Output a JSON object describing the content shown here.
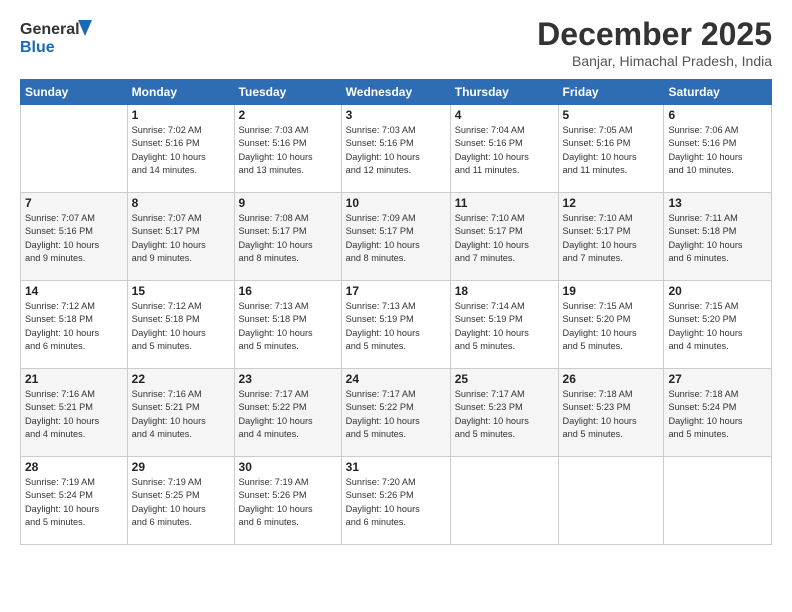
{
  "logo": {
    "line1": "General",
    "line2": "Blue"
  },
  "title": "December 2025",
  "subtitle": "Banjar, Himachal Pradesh, India",
  "days_of_week": [
    "Sunday",
    "Monday",
    "Tuesday",
    "Wednesday",
    "Thursday",
    "Friday",
    "Saturday"
  ],
  "weeks": [
    [
      {
        "num": "",
        "info": ""
      },
      {
        "num": "1",
        "info": "Sunrise: 7:02 AM\nSunset: 5:16 PM\nDaylight: 10 hours\nand 14 minutes."
      },
      {
        "num": "2",
        "info": "Sunrise: 7:03 AM\nSunset: 5:16 PM\nDaylight: 10 hours\nand 13 minutes."
      },
      {
        "num": "3",
        "info": "Sunrise: 7:03 AM\nSunset: 5:16 PM\nDaylight: 10 hours\nand 12 minutes."
      },
      {
        "num": "4",
        "info": "Sunrise: 7:04 AM\nSunset: 5:16 PM\nDaylight: 10 hours\nand 11 minutes."
      },
      {
        "num": "5",
        "info": "Sunrise: 7:05 AM\nSunset: 5:16 PM\nDaylight: 10 hours\nand 11 minutes."
      },
      {
        "num": "6",
        "info": "Sunrise: 7:06 AM\nSunset: 5:16 PM\nDaylight: 10 hours\nand 10 minutes."
      }
    ],
    [
      {
        "num": "7",
        "info": "Sunrise: 7:07 AM\nSunset: 5:16 PM\nDaylight: 10 hours\nand 9 minutes."
      },
      {
        "num": "8",
        "info": "Sunrise: 7:07 AM\nSunset: 5:17 PM\nDaylight: 10 hours\nand 9 minutes."
      },
      {
        "num": "9",
        "info": "Sunrise: 7:08 AM\nSunset: 5:17 PM\nDaylight: 10 hours\nand 8 minutes."
      },
      {
        "num": "10",
        "info": "Sunrise: 7:09 AM\nSunset: 5:17 PM\nDaylight: 10 hours\nand 8 minutes."
      },
      {
        "num": "11",
        "info": "Sunrise: 7:10 AM\nSunset: 5:17 PM\nDaylight: 10 hours\nand 7 minutes."
      },
      {
        "num": "12",
        "info": "Sunrise: 7:10 AM\nSunset: 5:17 PM\nDaylight: 10 hours\nand 7 minutes."
      },
      {
        "num": "13",
        "info": "Sunrise: 7:11 AM\nSunset: 5:18 PM\nDaylight: 10 hours\nand 6 minutes."
      }
    ],
    [
      {
        "num": "14",
        "info": "Sunrise: 7:12 AM\nSunset: 5:18 PM\nDaylight: 10 hours\nand 6 minutes."
      },
      {
        "num": "15",
        "info": "Sunrise: 7:12 AM\nSunset: 5:18 PM\nDaylight: 10 hours\nand 5 minutes."
      },
      {
        "num": "16",
        "info": "Sunrise: 7:13 AM\nSunset: 5:18 PM\nDaylight: 10 hours\nand 5 minutes."
      },
      {
        "num": "17",
        "info": "Sunrise: 7:13 AM\nSunset: 5:19 PM\nDaylight: 10 hours\nand 5 minutes."
      },
      {
        "num": "18",
        "info": "Sunrise: 7:14 AM\nSunset: 5:19 PM\nDaylight: 10 hours\nand 5 minutes."
      },
      {
        "num": "19",
        "info": "Sunrise: 7:15 AM\nSunset: 5:20 PM\nDaylight: 10 hours\nand 5 minutes."
      },
      {
        "num": "20",
        "info": "Sunrise: 7:15 AM\nSunset: 5:20 PM\nDaylight: 10 hours\nand 4 minutes."
      }
    ],
    [
      {
        "num": "21",
        "info": "Sunrise: 7:16 AM\nSunset: 5:21 PM\nDaylight: 10 hours\nand 4 minutes."
      },
      {
        "num": "22",
        "info": "Sunrise: 7:16 AM\nSunset: 5:21 PM\nDaylight: 10 hours\nand 4 minutes."
      },
      {
        "num": "23",
        "info": "Sunrise: 7:17 AM\nSunset: 5:22 PM\nDaylight: 10 hours\nand 4 minutes."
      },
      {
        "num": "24",
        "info": "Sunrise: 7:17 AM\nSunset: 5:22 PM\nDaylight: 10 hours\nand 5 minutes."
      },
      {
        "num": "25",
        "info": "Sunrise: 7:17 AM\nSunset: 5:23 PM\nDaylight: 10 hours\nand 5 minutes."
      },
      {
        "num": "26",
        "info": "Sunrise: 7:18 AM\nSunset: 5:23 PM\nDaylight: 10 hours\nand 5 minutes."
      },
      {
        "num": "27",
        "info": "Sunrise: 7:18 AM\nSunset: 5:24 PM\nDaylight: 10 hours\nand 5 minutes."
      }
    ],
    [
      {
        "num": "28",
        "info": "Sunrise: 7:19 AM\nSunset: 5:24 PM\nDaylight: 10 hours\nand 5 minutes."
      },
      {
        "num": "29",
        "info": "Sunrise: 7:19 AM\nSunset: 5:25 PM\nDaylight: 10 hours\nand 6 minutes."
      },
      {
        "num": "30",
        "info": "Sunrise: 7:19 AM\nSunset: 5:26 PM\nDaylight: 10 hours\nand 6 minutes."
      },
      {
        "num": "31",
        "info": "Sunrise: 7:20 AM\nSunset: 5:26 PM\nDaylight: 10 hours\nand 6 minutes."
      },
      {
        "num": "",
        "info": ""
      },
      {
        "num": "",
        "info": ""
      },
      {
        "num": "",
        "info": ""
      }
    ]
  ]
}
